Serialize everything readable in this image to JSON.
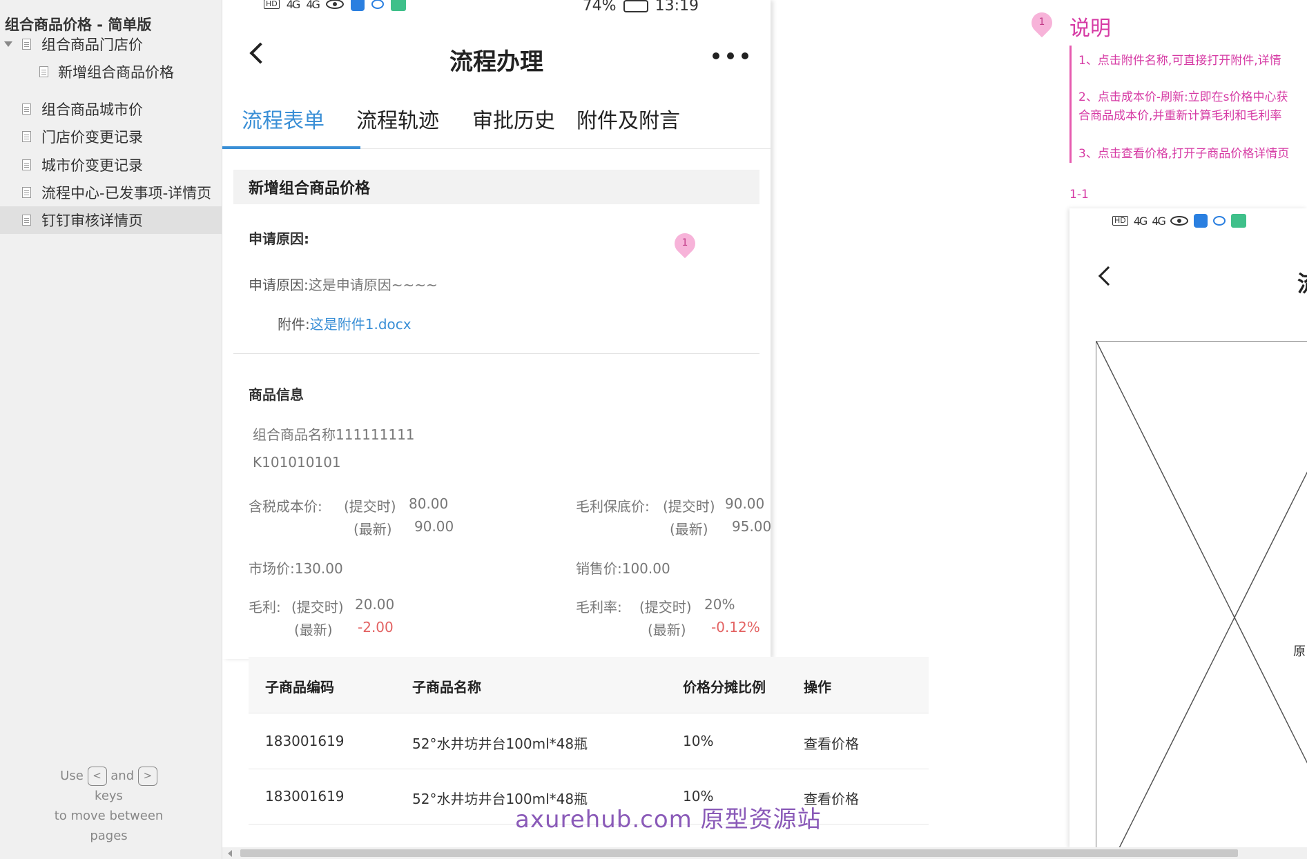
{
  "sidebar": {
    "project_title": "组合商品价格 - 简单版",
    "items": [
      {
        "label": "组合商品门店价"
      },
      {
        "label": "新增组合商品价格"
      },
      {
        "label": "组合商品城市价"
      },
      {
        "label": "门店价变更记录"
      },
      {
        "label": "城市价变更记录"
      },
      {
        "label": "流程中心-已发事项-详情页"
      },
      {
        "label": "钉钉审核详情页"
      }
    ],
    "help": {
      "use": "Use",
      "and": "and",
      "keys": "keys",
      "to_move": "to move between",
      "pages": "pages",
      "prev_key": "<",
      "next_key": ">"
    }
  },
  "phone": {
    "status_bar": {
      "hd1": "HD",
      "signal1": "4G",
      "signal2": "4G",
      "battery": "74%",
      "time": "13:19"
    },
    "nav_title": "流程办理",
    "tabs": [
      {
        "label": "流程表单"
      },
      {
        "label": "流程轨迹"
      },
      {
        "label": "审批历史"
      },
      {
        "label": "附件及附言"
      }
    ],
    "section_title": "新增组合商品价格",
    "apply_reason_heading": "申请原因:",
    "apply_reason_label": "申请原因:",
    "apply_reason_value": "这是申请原因~~~~",
    "attachment_label": "附件:",
    "attachment_value": "这是附件1.docx",
    "pin_number": "1",
    "goods_heading": "商品信息",
    "goods_name": "组合商品名称111111111",
    "goods_code": "K101010101",
    "tax_cost_label": "含税成本价:",
    "tax_cost_submit_tag": "(提交时)",
    "tax_cost_submit_value": "80.00",
    "tax_cost_latest_tag": "(最新)",
    "tax_cost_latest_value": "90.00",
    "floor_price_label": "毛利保底价:",
    "floor_price_submit_tag": "(提交时)",
    "floor_price_submit_value": "90.00",
    "floor_price_latest_tag": "(最新)",
    "floor_price_latest_value": "95.00",
    "market_price": "市场价:130.00",
    "sale_price": "销售价:100.00",
    "gross_label": "毛利:",
    "gross_submit_tag": "(提交时)",
    "gross_submit_value": "20.00",
    "gross_latest_tag": "(最新)",
    "gross_latest_value": "-2.00",
    "gross_rate_label": "毛利率:",
    "gross_rate_submit_tag": "(提交时)",
    "gross_rate_submit_value": "20%",
    "gross_rate_latest_tag": "(最新)",
    "gross_rate_latest_value": "-0.12%"
  },
  "table": {
    "headers": [
      "子商品编码",
      "子商品名称",
      "价格分摊比例",
      "操作"
    ],
    "rows": [
      {
        "code": "183001619",
        "name": "52°水井坊井台100ml*48瓶",
        "ratio": "10%",
        "action": "查看价格"
      },
      {
        "code": "183001619",
        "name": "52°水井坊井台100ml*48瓶",
        "ratio": "10%",
        "action": "查看价格"
      }
    ]
  },
  "watermark": "axurehub.com 原型资源站",
  "notes": {
    "pin_number": "1",
    "title": "说明",
    "line1": "1、点击附件名称,可直接打开附件,详情",
    "line2a": "2、点击成本价-刷新:立即在s价格中心获",
    "line2b": "合商品成本价,并重新计算毛利和毛利率",
    "line3": "3、点击查看价格,打开子商品价格详情页",
    "ref": "1-1"
  },
  "phone2": {
    "title_fragment": "流",
    "text_fragment": "原"
  },
  "colors": {
    "accent_blue": "#3a8fd6",
    "note_pink": "#d63aa4",
    "negative_red": "#e36262"
  }
}
